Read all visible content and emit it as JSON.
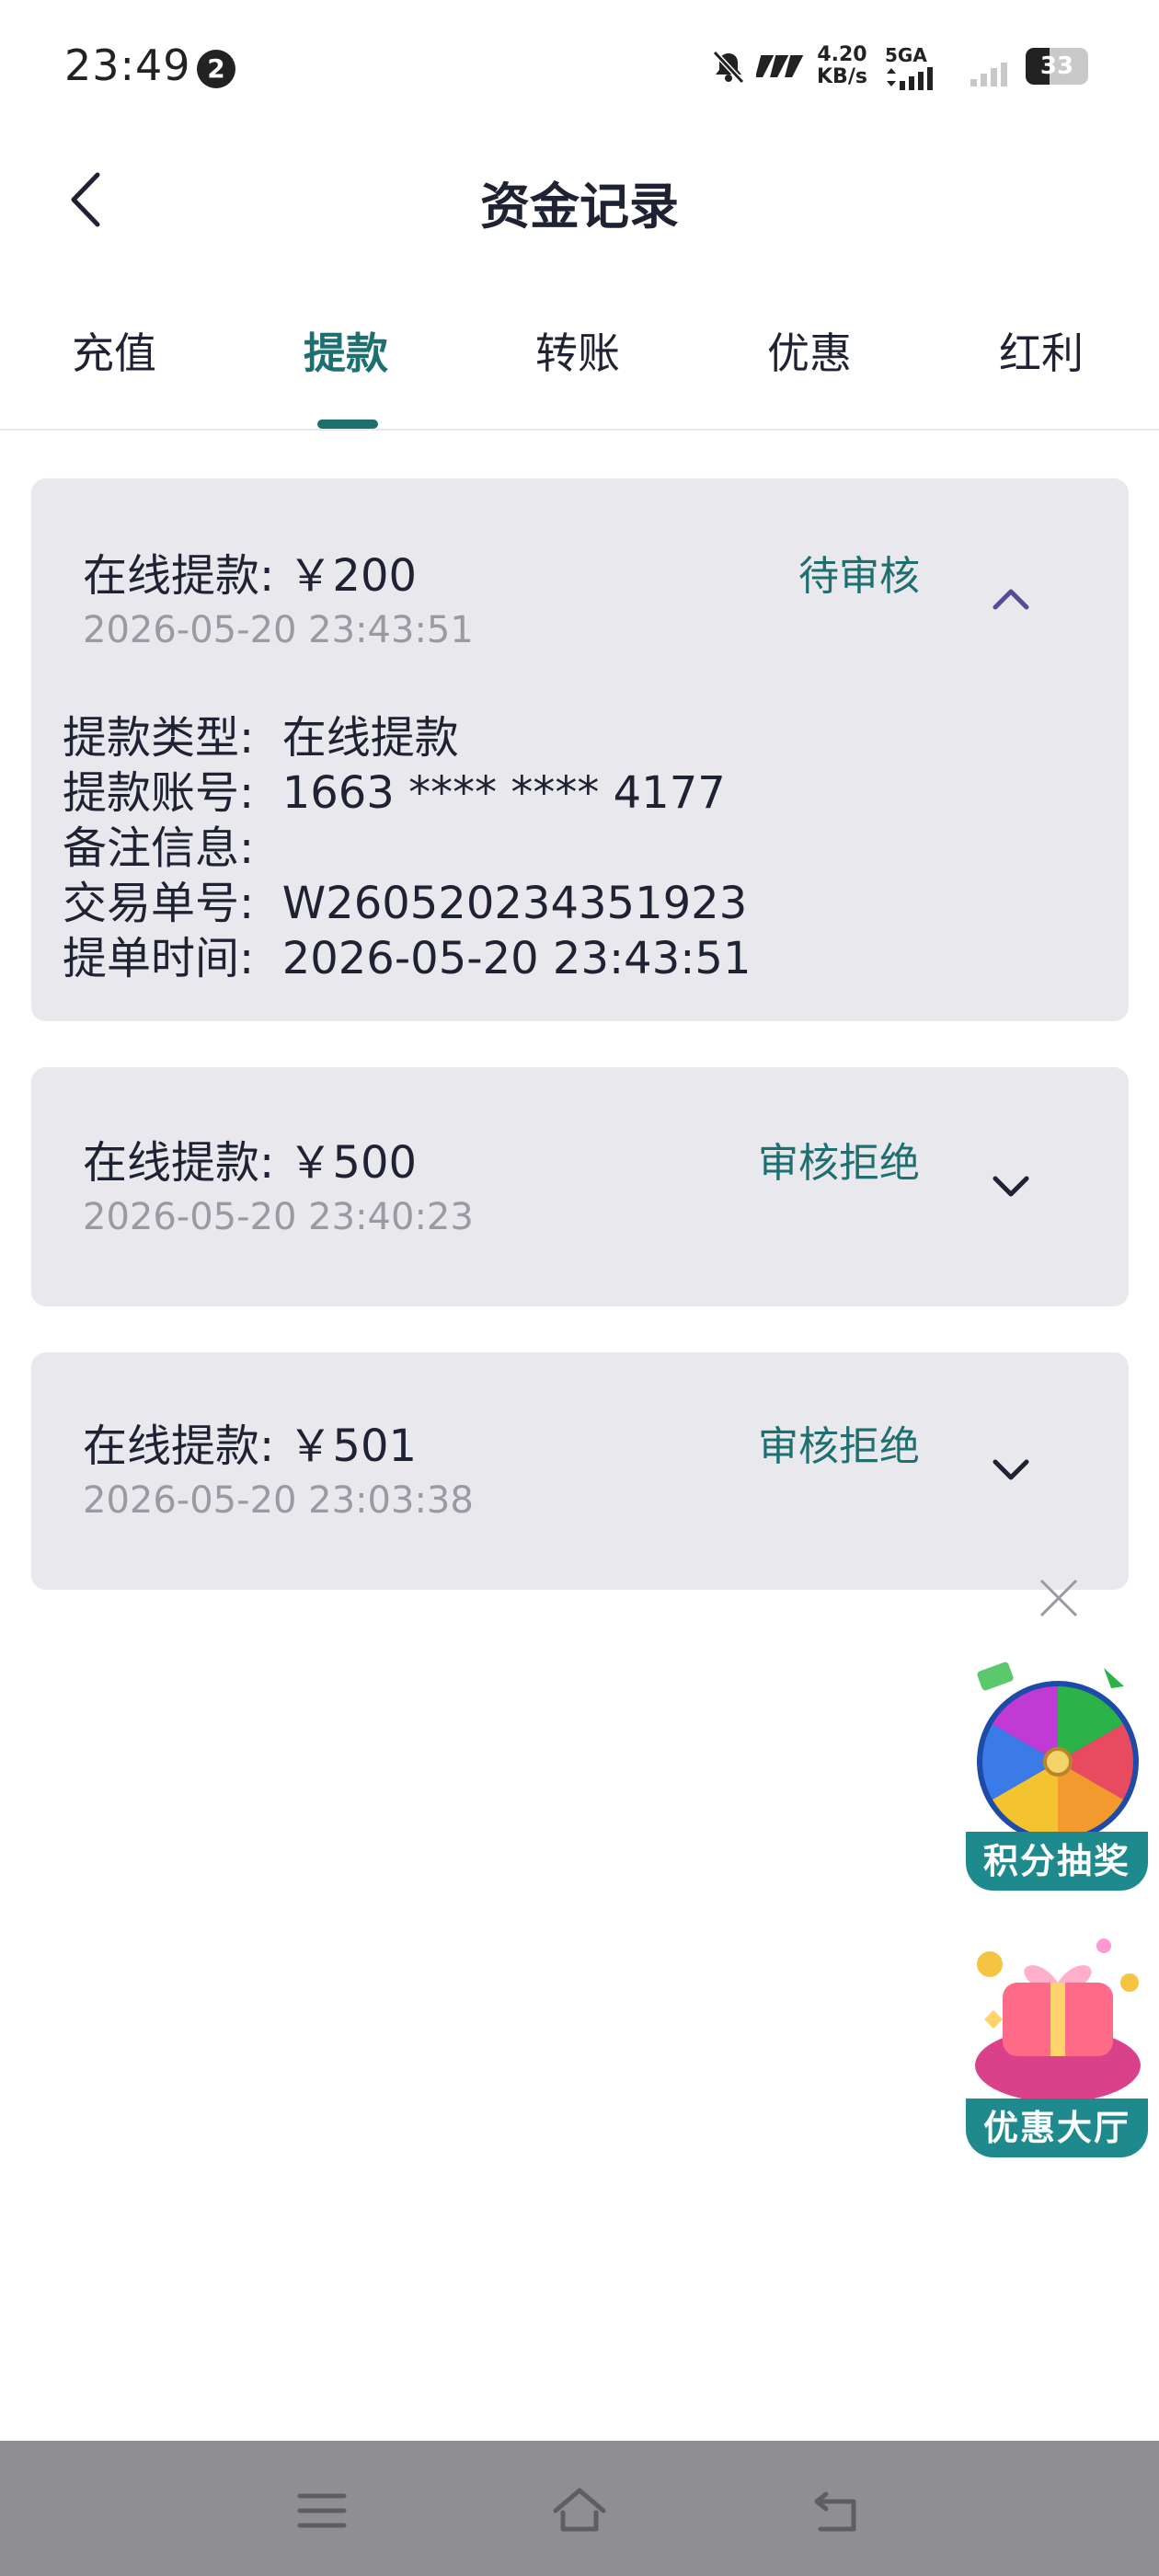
{
  "status_bar": {
    "time": "23:49",
    "notification_count": "2",
    "speed_value": "4.20",
    "speed_unit": "KB/s",
    "network": "5GA",
    "battery": "33"
  },
  "header": {
    "title": "资金记录"
  },
  "tabs": [
    {
      "label": "充值",
      "active": false
    },
    {
      "label": "提款",
      "active": true
    },
    {
      "label": "转账",
      "active": false
    },
    {
      "label": "优惠",
      "active": false
    },
    {
      "label": "红利",
      "active": false
    }
  ],
  "records": [
    {
      "title": "在线提款: ￥200",
      "time": "2026-05-20 23:43:51",
      "status": "待审核",
      "expanded": true,
      "details": [
        "提款类型:  在线提款",
        "提款账号:  1663 **** **** 4177",
        "备注信息:",
        "交易单号:  W260520234351923",
        "提单时间:  2026-05-20 23:43:51"
      ]
    },
    {
      "title": "在线提款: ￥500",
      "time": "2026-05-20 23:40:23",
      "status": "审核拒绝",
      "expanded": false
    },
    {
      "title": "在线提款: ￥501",
      "time": "2026-05-20 23:03:38",
      "status": "审核拒绝",
      "expanded": false
    }
  ],
  "promos": {
    "lottery_label": "积分抽奖",
    "offers_label": "优惠大厅"
  },
  "colors": {
    "accent": "#1e6f70",
    "card_bg": "#e8e8ed",
    "chevron_up": "#5a4a9a",
    "navbar": "#8e8e93"
  }
}
